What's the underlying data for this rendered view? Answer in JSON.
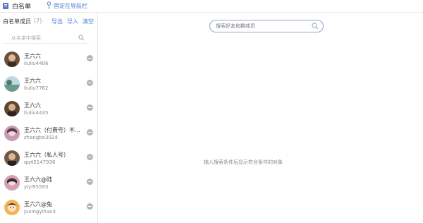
{
  "topbar": {
    "title": "白名单",
    "pin_label": "固定在导航栏"
  },
  "sidebar": {
    "header_label": "白名单成员",
    "count": "(7)",
    "actions": [
      "导出",
      "导入",
      "清空"
    ],
    "search_placeholder": "从名单中搜索"
  },
  "members": [
    {
      "name": "王六六",
      "id": "liuliu4406",
      "avatar_color": "#6b4f3a"
    },
    {
      "name": "王六六",
      "id": "liuliu7762",
      "avatar_color": "#6a9a8a"
    },
    {
      "name": "王六六",
      "id": "liuliu4435",
      "avatar_color": "#5c4634"
    },
    {
      "name": "王六六（付费号）不...",
      "id": "zhangbo3024",
      "avatar_color": "#c89ab0"
    },
    {
      "name": "王六六（私人号）",
      "id": "qq45147936",
      "avatar_color": "#6e5a48"
    },
    {
      "name": "王六六@陆",
      "id": "yiyi95593",
      "avatar_color": "#d2a0b2"
    },
    {
      "name": "王六六@兔",
      "id": "juxingyihao3",
      "avatar_color": "#f2b35b"
    }
  ],
  "main": {
    "search_placeholder": "搜索好友和群成员",
    "empty_message": "输入搜索条件后显示符合条件的对象"
  },
  "colors": {
    "accent": "#4a7fd6",
    "remove_button": "#b4b4b4"
  }
}
